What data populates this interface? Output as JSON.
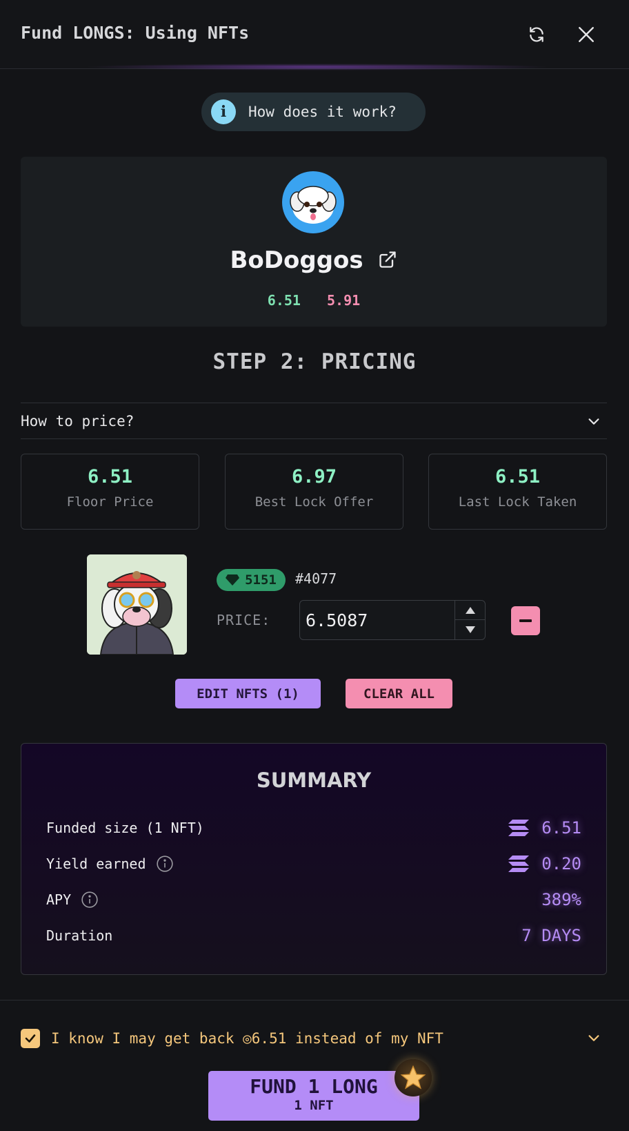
{
  "header": {
    "title": "Fund LONGS: Using NFTs",
    "refresh_icon": "refresh-icon",
    "close_icon": "close-icon"
  },
  "how_it_works": {
    "label": "How does it work?",
    "icon": "info-icon"
  },
  "collection": {
    "name": "BoDoggos",
    "price_green": "6.51",
    "price_pink": "5.91"
  },
  "step_title": "STEP 2: PRICING",
  "how_to_price": {
    "label": "How to price?"
  },
  "stats": [
    {
      "value": "6.51",
      "label": "Floor Price"
    },
    {
      "value": "6.97",
      "label": "Best Lock Offer"
    },
    {
      "value": "6.51",
      "label": "Last Lock Taken"
    }
  ],
  "nft": {
    "rank": "5151",
    "token_id": "#4077",
    "price_label": "PRICE:",
    "price_value": "6.5087"
  },
  "buttons": {
    "edit_nfts": "EDIT NFTS (1)",
    "clear_all": "CLEAR ALL"
  },
  "summary": {
    "title": "SUMMARY",
    "rows": [
      {
        "label": "Funded size (1 NFT)",
        "value": "6.51"
      },
      {
        "label": "Yield earned",
        "value": "0.20"
      },
      {
        "label": "APY",
        "value": "389%"
      },
      {
        "label": "Duration",
        "value": "7 DAYS"
      }
    ]
  },
  "acknowledgement": {
    "checked": true,
    "text": "I know I may get back ◎6.51 instead of my NFT"
  },
  "fund_button": {
    "main": "FUND 1 LONG",
    "sub": "1 NFT"
  },
  "colors": {
    "accent_purple": "#b48cf7",
    "pink": "#f48eb0",
    "green": "#8ef0c4",
    "gold": "#f5c77c"
  }
}
